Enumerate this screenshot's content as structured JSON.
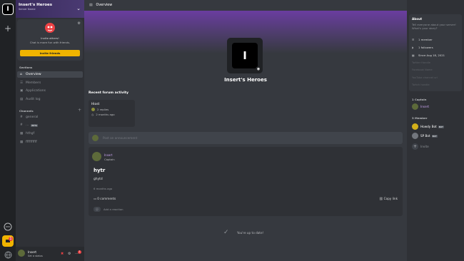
{
  "rail": {
    "server_initial": "I"
  },
  "server": {
    "name": "Insert's Heroes",
    "subtitle": "Server Name"
  },
  "invite": {
    "line1": "Invite others!",
    "line2": "Chat is more fun with friends.",
    "button": "Invite friends"
  },
  "sections": {
    "label": "Sections",
    "items": [
      {
        "label": "Overview",
        "icon": "home-icon",
        "active": true
      },
      {
        "label": "Members",
        "icon": "members-icon"
      },
      {
        "label": "Applications",
        "icon": "apps-icon"
      },
      {
        "label": "Audit log",
        "icon": "log-icon"
      }
    ]
  },
  "channels": {
    "label": "Channels",
    "items": [
      {
        "label": "general",
        "icon": "hash-icon"
      },
      {
        "label": "...",
        "icon": "hash-icon",
        "badge": "BETA"
      },
      {
        "label": "hthgf",
        "icon": "forum-icon"
      },
      {
        "label": "ffffffffff",
        "icon": "forum-icon"
      }
    ]
  },
  "user": {
    "name": "Insert",
    "status": "Set a status",
    "badge": "1"
  },
  "main": {
    "title": "Overview",
    "server_icon_letter": "I",
    "server_name": "Insert's Heroes",
    "recent_label": "Recent forum activity",
    "forum_card": {
      "title": "Hiost",
      "replies": "2 replies",
      "time": "2 months ago"
    },
    "post_placeholder": "Post an announcement",
    "post": {
      "author": "Insert",
      "role": "Captain",
      "title": "hytr",
      "body": "ghytd",
      "time": "6 months ago",
      "comments": "0 comments",
      "copy": "Copy link",
      "reaction": "Add a reaction"
    },
    "up_to_date": "You're up to date!"
  },
  "about": {
    "heading": "About",
    "desc": "Tell everyone about your server! What's your story?",
    "stats": [
      {
        "label": "1 member",
        "icon": "members-icon"
      },
      {
        "label": "1 followers",
        "icon": "rss-icon"
      },
      {
        "label": "Since Aug 18, 2021",
        "icon": "calendar-icon"
      }
    ],
    "links": [
      "Twitter Handle",
      "Facebook Name",
      "YouTube channel url",
      "Twitch handle"
    ]
  },
  "members": {
    "group1": "1 Captain",
    "captains": [
      {
        "name": "Insert",
        "color": "#c9a4f0"
      }
    ],
    "group2": "3 Member",
    "list": [
      {
        "name": "Howdy Bot",
        "bot": "BOT"
      },
      {
        "name": "SP Bot",
        "bot": "BOT"
      },
      {
        "name": "Invite",
        "invite": true
      }
    ]
  }
}
